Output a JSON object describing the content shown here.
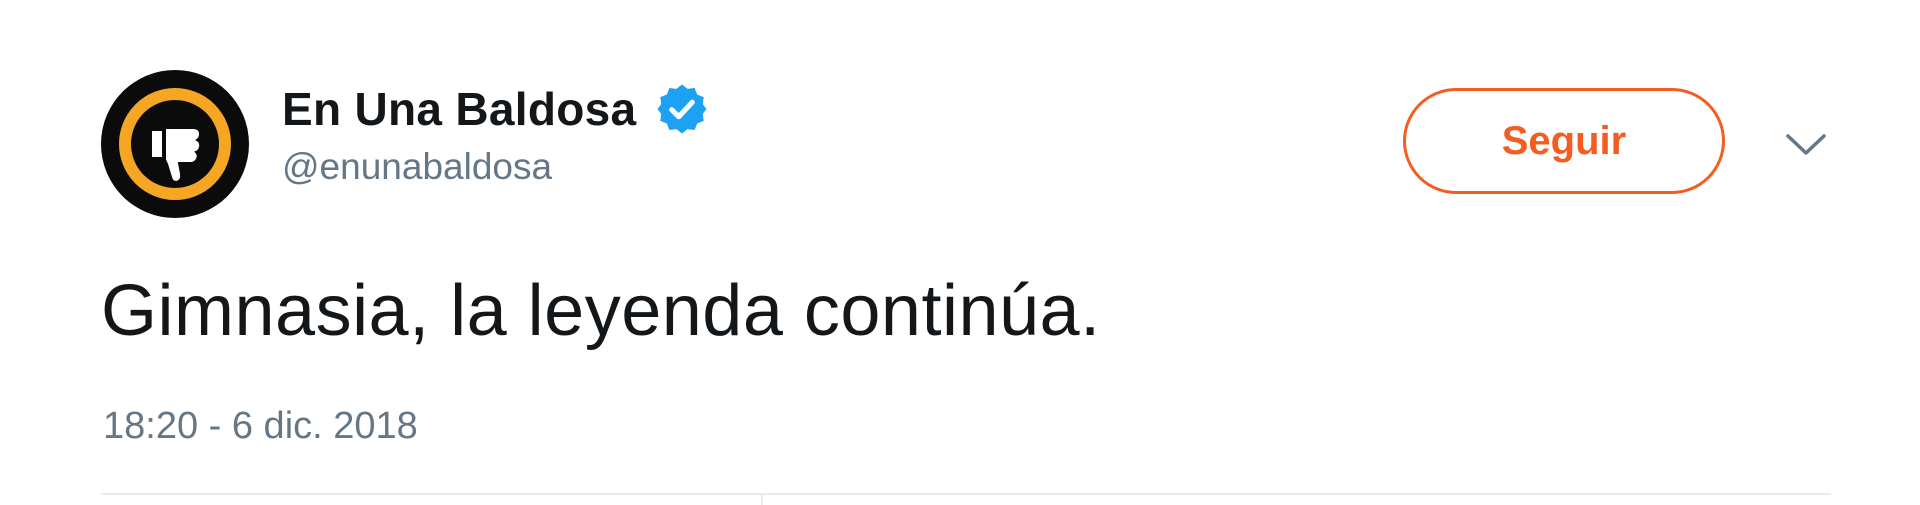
{
  "user": {
    "display_name": "En Una Baldosa",
    "handle": "@enunabaldosa",
    "verified": true,
    "avatar_icon": "thumbs-down-icon"
  },
  "actions": {
    "follow_label": "Seguir",
    "more_icon": "chevron-down-icon"
  },
  "tweet": {
    "text": "Gimnasia, la leyenda continúa.",
    "timestamp": "18:20 - 6 dic. 2018"
  },
  "colors": {
    "accent": "#f45d22",
    "verified_blue": "#1da1f2",
    "avatar_ring": "#f5a623",
    "text_primary": "#14171a",
    "text_secondary": "#657786"
  }
}
